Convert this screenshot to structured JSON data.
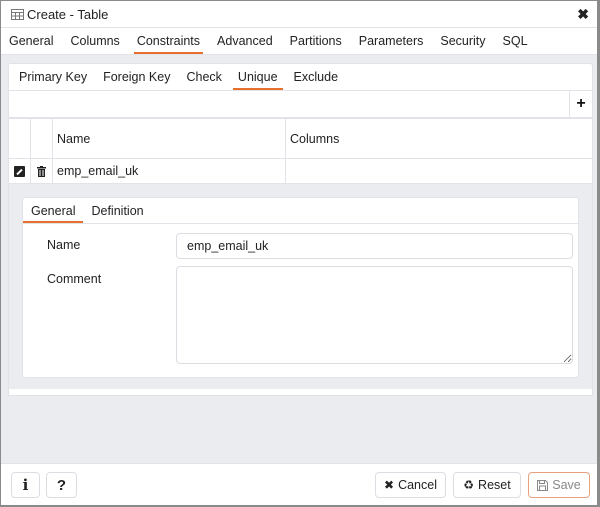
{
  "window": {
    "title": "Create - Table",
    "icon": "table-icon",
    "close_icon": "close-icon"
  },
  "main_tabs": [
    {
      "label": "General",
      "active": false
    },
    {
      "label": "Columns",
      "active": false
    },
    {
      "label": "Constraints",
      "active": true
    },
    {
      "label": "Advanced",
      "active": false
    },
    {
      "label": "Partitions",
      "active": false
    },
    {
      "label": "Parameters",
      "active": false
    },
    {
      "label": "Security",
      "active": false
    },
    {
      "label": "SQL",
      "active": false
    }
  ],
  "constraint_tabs": [
    {
      "label": "Primary Key",
      "active": false
    },
    {
      "label": "Foreign Key",
      "active": false
    },
    {
      "label": "Check",
      "active": false
    },
    {
      "label": "Unique",
      "active": true
    },
    {
      "label": "Exclude",
      "active": false
    }
  ],
  "grid": {
    "add_label": "+",
    "columns": [
      "Name",
      "Columns"
    ],
    "rows": [
      {
        "name": "emp_email_uk",
        "columns": ""
      }
    ]
  },
  "detail": {
    "tabs": [
      {
        "label": "General",
        "active": true
      },
      {
        "label": "Definition",
        "active": false
      }
    ],
    "name_label": "Name",
    "name_value": "emp_email_uk",
    "comment_label": "Comment",
    "comment_value": ""
  },
  "footer": {
    "info_label": "i",
    "help_label": "?",
    "cancel_label": "Cancel",
    "reset_label": "Reset",
    "save_label": "Save"
  },
  "colors": {
    "accent": "#e8702c",
    "save_border": "#e8a07f",
    "background": "#ebecf0"
  }
}
